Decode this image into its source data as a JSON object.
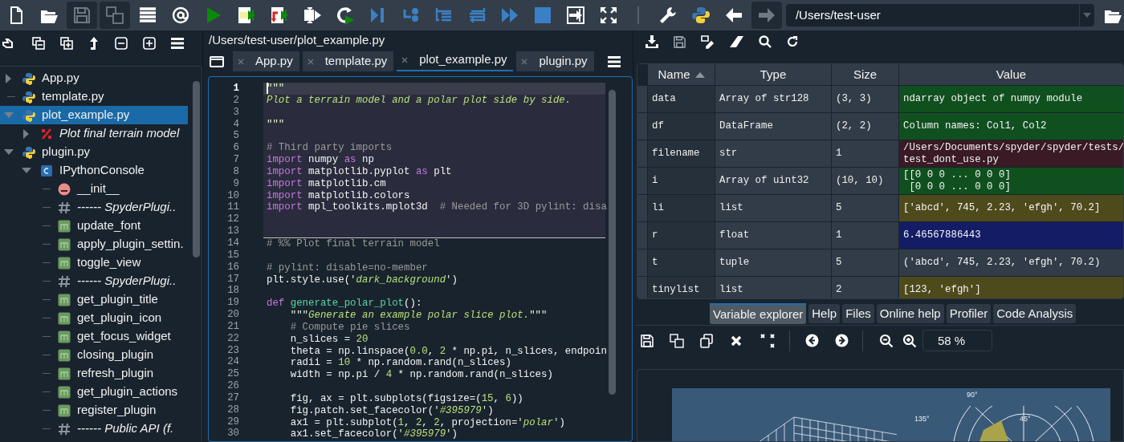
{
  "toolbar": {
    "buttons": [
      {
        "kind": "new-file",
        "disabled": false
      },
      {
        "kind": "open",
        "disabled": false
      },
      {
        "kind": "save",
        "disabled": true
      },
      {
        "kind": "save-all",
        "disabled": true
      },
      {
        "kind": "list",
        "disabled": false
      },
      {
        "kind": "at",
        "disabled": false
      },
      {
        "kind": "run",
        "disabled": false
      },
      {
        "kind": "run-cell",
        "disabled": false
      },
      {
        "kind": "run-cell-advance",
        "disabled": false
      },
      {
        "kind": "run-selection",
        "disabled": false
      },
      {
        "kind": "rerun",
        "disabled": false
      },
      {
        "kind": "debug",
        "disabled": false
      },
      {
        "kind": "step",
        "disabled": false
      },
      {
        "kind": "step-into",
        "disabled": false
      },
      {
        "kind": "step-return",
        "disabled": false
      },
      {
        "kind": "continue",
        "disabled": false
      },
      {
        "kind": "stop",
        "disabled": false
      },
      {
        "kind": "maximize",
        "disabled": false
      },
      {
        "kind": "fullscreen",
        "disabled": false
      },
      {
        "kind": "separator"
      },
      {
        "kind": "wrench",
        "disabled": false
      },
      {
        "kind": "python",
        "disabled": false
      },
      {
        "kind": "back",
        "disabled": false
      },
      {
        "kind": "forward",
        "disabled": true
      }
    ],
    "path": "/Users/test-user"
  },
  "outline": {
    "items": [
      {
        "label": "App.py",
        "kind": "module",
        "expanded": false,
        "selected": false
      },
      {
        "label": "template.py",
        "kind": "module",
        "selected": false
      },
      {
        "label": "plot_example.py",
        "kind": "module",
        "expanded": true,
        "selected": true,
        "children": [
          {
            "label": "Plot final terrain model",
            "kind": "cell",
            "expanded": false,
            "selected": false
          }
        ]
      },
      {
        "label": "plugin.py",
        "kind": "module",
        "expanded": true,
        "selected": false,
        "children": [
          {
            "label": "IPythonConsole",
            "kind": "class",
            "expanded": true,
            "selected": false,
            "children": [
              {
                "label": "__init__",
                "kind": "function",
                "selected": false
              },
              {
                "label": "------ SpyderPlugi..",
                "kind": "comment",
                "selected": false
              },
              {
                "label": "update_font",
                "kind": "method",
                "selected": false
              },
              {
                "label": "apply_plugin_settin.",
                "kind": "method",
                "selected": false
              },
              {
                "label": "toggle_view",
                "kind": "method",
                "selected": false
              },
              {
                "label": "------ SpyderPlugi..",
                "kind": "comment",
                "selected": false
              },
              {
                "label": "get_plugin_title",
                "kind": "method",
                "selected": false
              },
              {
                "label": "get_plugin_icon",
                "kind": "method",
                "selected": false
              },
              {
                "label": "get_focus_widget",
                "kind": "method",
                "selected": false
              },
              {
                "label": "closing_plugin",
                "kind": "method",
                "selected": false
              },
              {
                "label": "refresh_plugin",
                "kind": "method",
                "selected": false
              },
              {
                "label": "get_plugin_actions",
                "kind": "method",
                "selected": false
              },
              {
                "label": "register_plugin",
                "kind": "method",
                "selected": false
              },
              {
                "label": "------ Public API (f.",
                "kind": "comment",
                "selected": false
              }
            ]
          }
        ]
      }
    ]
  },
  "editor": {
    "path": "/Users/test-user/plot_example.py",
    "tabs": [
      {
        "label": "App.py",
        "selected": false
      },
      {
        "label": "template.py",
        "selected": false
      },
      {
        "label": "plot_example.py",
        "selected": true
      },
      {
        "label": "plugin.py",
        "selected": false
      }
    ],
    "cells": [
      {
        "active": true,
        "lines": [
          {
            "number": "1",
            "current": true,
            "tokens": [
              {
                "kind": "q",
                "text": "\"\"\""
              }
            ]
          },
          {
            "number": "2",
            "current": false,
            "tokens": [
              {
                "kind": "doc",
                "text": "Plot a terrain model and a polar plot side by side."
              }
            ]
          },
          {
            "number": "3",
            "current": false
          },
          {
            "number": "4",
            "current": false,
            "tokens": [
              {
                "kind": "q",
                "text": "\"\"\""
              }
            ]
          },
          {
            "number": "5",
            "current": false
          },
          {
            "number": "6",
            "current": false,
            "tokens": [
              {
                "kind": "com",
                "text": "# Third party imports"
              }
            ]
          },
          {
            "number": "7",
            "current": false,
            "tokens": [
              {
                "kind": "kw",
                "text": "import"
              },
              {
                "kind": "p",
                "text": " numpy "
              },
              {
                "kind": "kw",
                "text": "as"
              },
              {
                "kind": "p",
                "text": " np"
              }
            ]
          },
          {
            "number": "8",
            "current": false,
            "tokens": [
              {
                "kind": "kw",
                "text": "import"
              },
              {
                "kind": "p",
                "text": " matplotlib.pyplot "
              },
              {
                "kind": "kw",
                "text": "as"
              },
              {
                "kind": "p",
                "text": " plt"
              }
            ]
          },
          {
            "number": "9",
            "current": false,
            "tokens": [
              {
                "kind": "kw",
                "text": "import"
              },
              {
                "kind": "p",
                "text": " matplotlib.cm"
              }
            ]
          },
          {
            "number": "10",
            "current": false,
            "tokens": [
              {
                "kind": "kw",
                "text": "import"
              },
              {
                "kind": "p",
                "text": " matplotlib.colors"
              }
            ]
          },
          {
            "number": "11",
            "current": false,
            "tokens": [
              {
                "kind": "kw",
                "text": "import"
              },
              {
                "kind": "p",
                "text": " mpl_toolkits.mplot3d  "
              },
              {
                "kind": "com",
                "text": "# Needed for 3D pylint: disa"
              }
            ]
          },
          {
            "number": "12",
            "current": false
          },
          {
            "number": "13",
            "current": false
          }
        ]
      },
      {
        "active": false,
        "lines": [
          {
            "number": "14",
            "current": false,
            "tokens": [
              {
                "kind": "com",
                "text": "# %% Plot final terrain model"
              }
            ]
          },
          {
            "number": "15",
            "current": false
          },
          {
            "number": "16",
            "current": false,
            "tokens": [
              {
                "kind": "com",
                "text": "# pylint: disable=no-member"
              }
            ]
          },
          {
            "number": "17",
            "current": false,
            "tokens": [
              {
                "kind": "p",
                "text": "plt.style.use("
              },
              {
                "kind": "q",
                "text": "'"
              },
              {
                "kind": "str",
                "text": "dark_background"
              },
              {
                "kind": "q",
                "text": "'"
              },
              {
                "kind": "p",
                "text": ")"
              }
            ]
          },
          {
            "number": "18",
            "current": false
          },
          {
            "number": "19",
            "current": false,
            "tokens": [
              {
                "kind": "kw",
                "text": "def"
              },
              {
                "kind": "fn",
                "text": " generate_polar_plot"
              },
              {
                "kind": "p",
                "text": "():"
              }
            ]
          },
          {
            "number": "20",
            "current": false,
            "tokens": [
              {
                "kind": "q",
                "text": "    \"\"\""
              },
              {
                "kind": "doc",
                "text": "Generate an example polar slice plot."
              },
              {
                "kind": "q",
                "text": "\"\"\""
              }
            ]
          },
          {
            "number": "21",
            "current": false,
            "tokens": [
              {
                "kind": "com",
                "text": "    # Compute pie slices"
              }
            ]
          },
          {
            "number": "22",
            "current": false,
            "tokens": [
              {
                "kind": "p",
                "text": "    n_slices = "
              },
              {
                "kind": "num",
                "text": "20"
              }
            ]
          },
          {
            "number": "23",
            "current": false,
            "tokens": [
              {
                "kind": "p",
                "text": "    theta = np.linspace("
              },
              {
                "kind": "num",
                "text": "0.0"
              },
              {
                "kind": "p",
                "text": ", "
              },
              {
                "kind": "num",
                "text": "2"
              },
              {
                "kind": "p",
                "text": " * np.pi, n_slices, endpoin"
              }
            ]
          },
          {
            "number": "24",
            "current": false,
            "tokens": [
              {
                "kind": "p",
                "text": "    radii = "
              },
              {
                "kind": "num",
                "text": "10"
              },
              {
                "kind": "p",
                "text": " * np.random.rand(n_slices)"
              }
            ]
          },
          {
            "number": "25",
            "current": false,
            "tokens": [
              {
                "kind": "p",
                "text": "    width = np.pi / "
              },
              {
                "kind": "num",
                "text": "4"
              },
              {
                "kind": "p",
                "text": " * np.random.rand(n_slices)"
              }
            ]
          },
          {
            "number": "26",
            "current": false
          },
          {
            "number": "27",
            "current": false,
            "tokens": [
              {
                "kind": "p",
                "text": "    fig, ax = plt.subplots(figsize=("
              },
              {
                "kind": "num",
                "text": "15"
              },
              {
                "kind": "p",
                "text": ", "
              },
              {
                "kind": "num",
                "text": "6"
              },
              {
                "kind": "p",
                "text": "))"
              }
            ]
          },
          {
            "number": "28",
            "current": false,
            "tokens": [
              {
                "kind": "p",
                "text": "    fig.patch.set_facecolor("
              },
              {
                "kind": "q",
                "text": "'"
              },
              {
                "kind": "str",
                "text": "#395979"
              },
              {
                "kind": "q",
                "text": "'"
              },
              {
                "kind": "p",
                "text": ")"
              }
            ]
          },
          {
            "number": "29",
            "current": false,
            "tokens": [
              {
                "kind": "p",
                "text": "    ax1 = plt.subplot("
              },
              {
                "kind": "num",
                "text": "1"
              },
              {
                "kind": "p",
                "text": ", "
              },
              {
                "kind": "num",
                "text": "2"
              },
              {
                "kind": "p",
                "text": ", "
              },
              {
                "kind": "num",
                "text": "2"
              },
              {
                "kind": "p",
                "text": ", projection="
              },
              {
                "kind": "q",
                "text": "'"
              },
              {
                "kind": "str",
                "text": "polar"
              },
              {
                "kind": "q",
                "text": "'"
              },
              {
                "kind": "p",
                "text": ")"
              }
            ]
          },
          {
            "number": "30",
            "current": false,
            "tokens": [
              {
                "kind": "p",
                "text": "    ax1.set_facecolor("
              },
              {
                "kind": "q",
                "text": "'"
              },
              {
                "kind": "str",
                "text": "#395979"
              },
              {
                "kind": "q",
                "text": "'"
              },
              {
                "kind": "p",
                "text": ")"
              }
            ]
          }
        ]
      }
    ]
  },
  "variable_explorer": {
    "columns": [
      {
        "label": "Name",
        "sorted": true
      },
      {
        "label": "Type",
        "sorted": false
      },
      {
        "label": "Size",
        "sorted": false
      },
      {
        "label": "Value",
        "sorted": false
      }
    ],
    "rows": [
      {
        "name": "data",
        "type": "Array of str128",
        "size": "(3, 3)",
        "value": "ndarray object of numpy module",
        "color": "#10501f"
      },
      {
        "name": "df",
        "type": "DataFrame",
        "size": "(2, 2)",
        "value": "Column names: Col1, Col2",
        "color": "#10501f"
      },
      {
        "name": "filename",
        "type": "str",
        "size": "1",
        "value": "/Users/Documents/spyder/spyder/tests/\ntest_dont_use.py",
        "color": "#3a1a24"
      },
      {
        "name": "i",
        "type": "Array of uint32",
        "size": "(10, 10)",
        "value": "[[0 0 0 ... 0 0 0]\n [0 0 0 ... 0 0 0]",
        "color": "#10501f"
      },
      {
        "name": "li",
        "type": "list",
        "size": "5",
        "value": "['abcd', 745, 2.23, 'efgh', 70.2]",
        "color": "#4d4b1c"
      },
      {
        "name": "r",
        "type": "float",
        "size": "1",
        "value": "6.46567886443",
        "color": "#151c66"
      },
      {
        "name": "t",
        "type": "tuple",
        "size": "5",
        "value": "('abcd', 745, 2.23, 'efgh', 70.2)"
      },
      {
        "name": "tinylist",
        "type": "list",
        "size": "2",
        "value": "[123, 'efgh']",
        "color": "#4d4b1c"
      }
    ]
  },
  "pane_tabs": [
    {
      "label": "Variable explorer",
      "selected": true
    },
    {
      "label": "Help",
      "selected": false
    },
    {
      "label": "Files",
      "selected": false
    },
    {
      "label": "Online help",
      "selected": false
    },
    {
      "label": "Profiler",
      "selected": false
    },
    {
      "label": "Code Analysis",
      "selected": false
    }
  ],
  "plots": {
    "zoom": "58 %",
    "figure": {
      "angle_labels": [
        "90°",
        "135°",
        "45°"
      ]
    }
  }
}
